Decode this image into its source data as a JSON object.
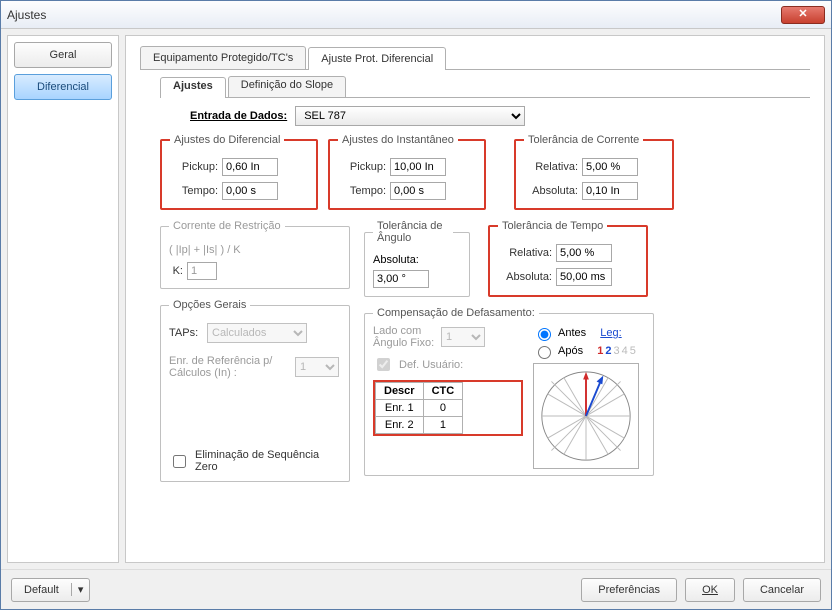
{
  "window": {
    "title": "Ajustes"
  },
  "sidebar": {
    "items": [
      "Geral",
      "Diferencial"
    ],
    "active": 1
  },
  "tabs": {
    "items": [
      "Equipamento Protegido/TC's",
      "Ajuste Prot. Diferencial"
    ],
    "active": 1
  },
  "subtabs": {
    "items": [
      "Ajustes",
      "Definição do Slope"
    ],
    "active": 0
  },
  "entrada": {
    "label": "Entrada de Dados:",
    "value": "SEL 787"
  },
  "diferencial": {
    "legend": "Ajustes do Diferencial",
    "pickup_label": "Pickup:",
    "pickup": "0,60 In",
    "tempo_label": "Tempo:",
    "tempo": "0,00 s"
  },
  "instantaneo": {
    "legend": "Ajustes do Instantâneo",
    "pickup_label": "Pickup:",
    "pickup": "10,00 In",
    "tempo_label": "Tempo:",
    "tempo": "0,00 s"
  },
  "tol_corrente": {
    "legend": "Tolerância de Corrente",
    "rel_label": "Relativa:",
    "rel": "5,00 %",
    "abs_label": "Absoluta:",
    "abs": "0,10 In"
  },
  "tol_tempo": {
    "legend": "Tolerância de Tempo",
    "rel_label": "Relativa:",
    "rel": "5,00 %",
    "abs_label": "Absoluta:",
    "abs": "50,00 ms"
  },
  "restricao": {
    "legend": "Corrente de Restrição",
    "formula": "( |Ip| + |Is| ) / K",
    "k_label": "K:",
    "k": "1"
  },
  "angulo": {
    "legend": "Tolerância de Ângulo",
    "abs_label": "Absoluta:",
    "abs": "3,00 °"
  },
  "opcoes": {
    "legend": "Opções Gerais",
    "taps_label": "TAPs:",
    "taps": "Calculados",
    "enr_label": "Enr. de Referência p/ Cálculos (In) :",
    "enr": "1",
    "elim_label": "Eliminação de Sequência Zero"
  },
  "comp": {
    "legend": "Compensação de Defasamento:",
    "lado_label": "Lado com Ângulo Fixo:",
    "lado": "1",
    "def_label": "Def. Usuário:",
    "antes": "Antes",
    "apos": "Após",
    "leg": "Leg:",
    "leg_nums": [
      "1",
      "2",
      "3",
      "4",
      "5"
    ],
    "table": {
      "headers": [
        "Descr",
        "CTC"
      ],
      "rows": [
        [
          "Enr. 1",
          "0"
        ],
        [
          "Enr. 2",
          "1"
        ]
      ]
    }
  },
  "footer": {
    "default": "Default",
    "pref": "Preferências",
    "ok": "OK",
    "cancel": "Cancelar"
  }
}
